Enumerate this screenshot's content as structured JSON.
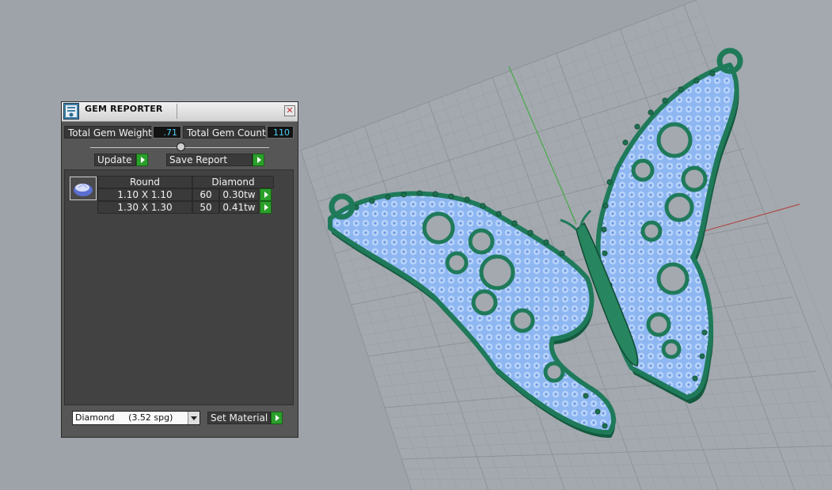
{
  "panel": {
    "title": "GEM REPORTER",
    "total_weight_label": "Total Gem Weight",
    "total_weight_value": ".71",
    "total_count_label": "Total Gem Count",
    "total_count_value": "110",
    "update_label": "Update",
    "save_report_label": "Save Report",
    "table": {
      "headers": [
        "Round",
        "Diamond"
      ],
      "rows": [
        {
          "size": "1.10 X 1.10",
          "count": "60",
          "weight": "0.30tw"
        },
        {
          "size": "1.30 X 1.30",
          "count": "50",
          "weight": "0.41tw"
        }
      ]
    },
    "material_select": "Diamond     (3.52 spg)",
    "set_material_label": "Set Material"
  },
  "colors": {
    "metal": "#1f7a5a",
    "gem": "#8fb8f4",
    "viewport_bg": "#9da3a8",
    "panel_bg": "#565656",
    "value_text": "#4fd0f7",
    "play_button": "#2ba02b"
  },
  "icons": [
    "gem-reporter-icon",
    "close-icon",
    "play-icon",
    "gem-thumbnail-icon",
    "chevron-down-icon"
  ]
}
